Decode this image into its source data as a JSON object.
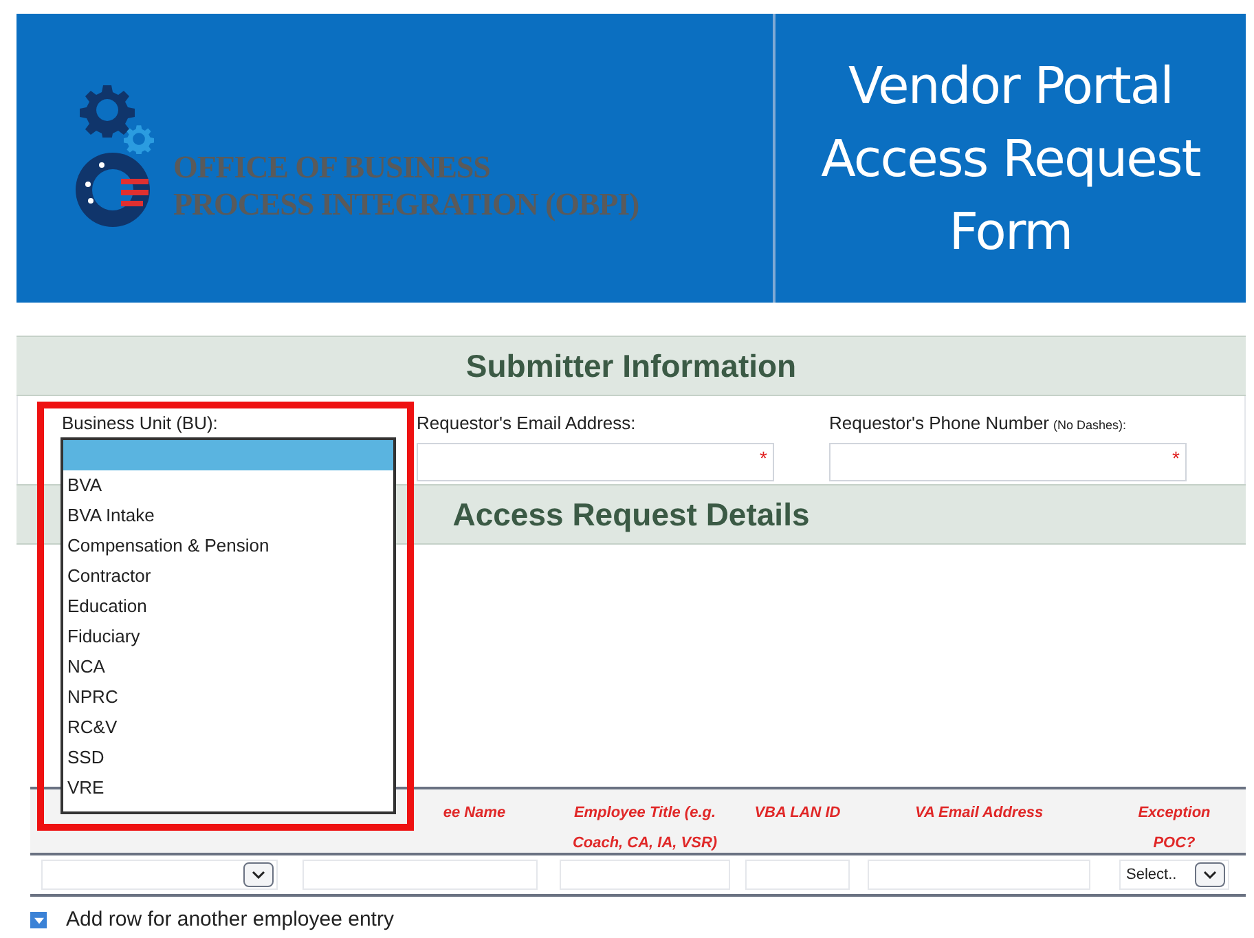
{
  "header": {
    "logo_lines": [
      "OFFICE OF BUSINESS",
      "PROCESS INTEGRATION (OBPI)"
    ],
    "title_lines": [
      "Vendor Portal",
      "Access Request",
      "Form"
    ]
  },
  "submitter": {
    "title": "Submitter Information",
    "business_unit": {
      "label": "Business Unit (BU):",
      "blank_option_highlighted": true,
      "options": [
        "BVA",
        "BVA Intake",
        "Compensation & Pension",
        "Contractor",
        "Education",
        "Fiduciary",
        "NCA",
        "NPRC",
        "RC&V",
        "SSD",
        "VRE"
      ]
    },
    "fields": [
      {
        "label": "Requestor's Email Address:",
        "required_mark": "*"
      },
      {
        "label": "Requestor's Phone Number",
        "note": "(No Dashes):",
        "required_mark": "*"
      }
    ]
  },
  "details": {
    "title": "Access Request Details"
  },
  "table": {
    "columns": [
      {
        "label": "ee Name"
      },
      {
        "label": "Employee Title (e.g. Coach, CA, IA, VSR)"
      },
      {
        "label": "VBA LAN ID"
      },
      {
        "label": "VA Email Address"
      },
      {
        "label": "Exception POC?"
      }
    ],
    "cells": [
      {
        "kind": "select"
      },
      {
        "kind": "text"
      },
      {
        "kind": "text"
      },
      {
        "kind": "text"
      },
      {
        "kind": "text"
      },
      {
        "kind": "select",
        "value": "Select.."
      }
    ]
  },
  "add_row": {
    "label": "Add row for another employee entry"
  },
  "highlight_box": true
}
